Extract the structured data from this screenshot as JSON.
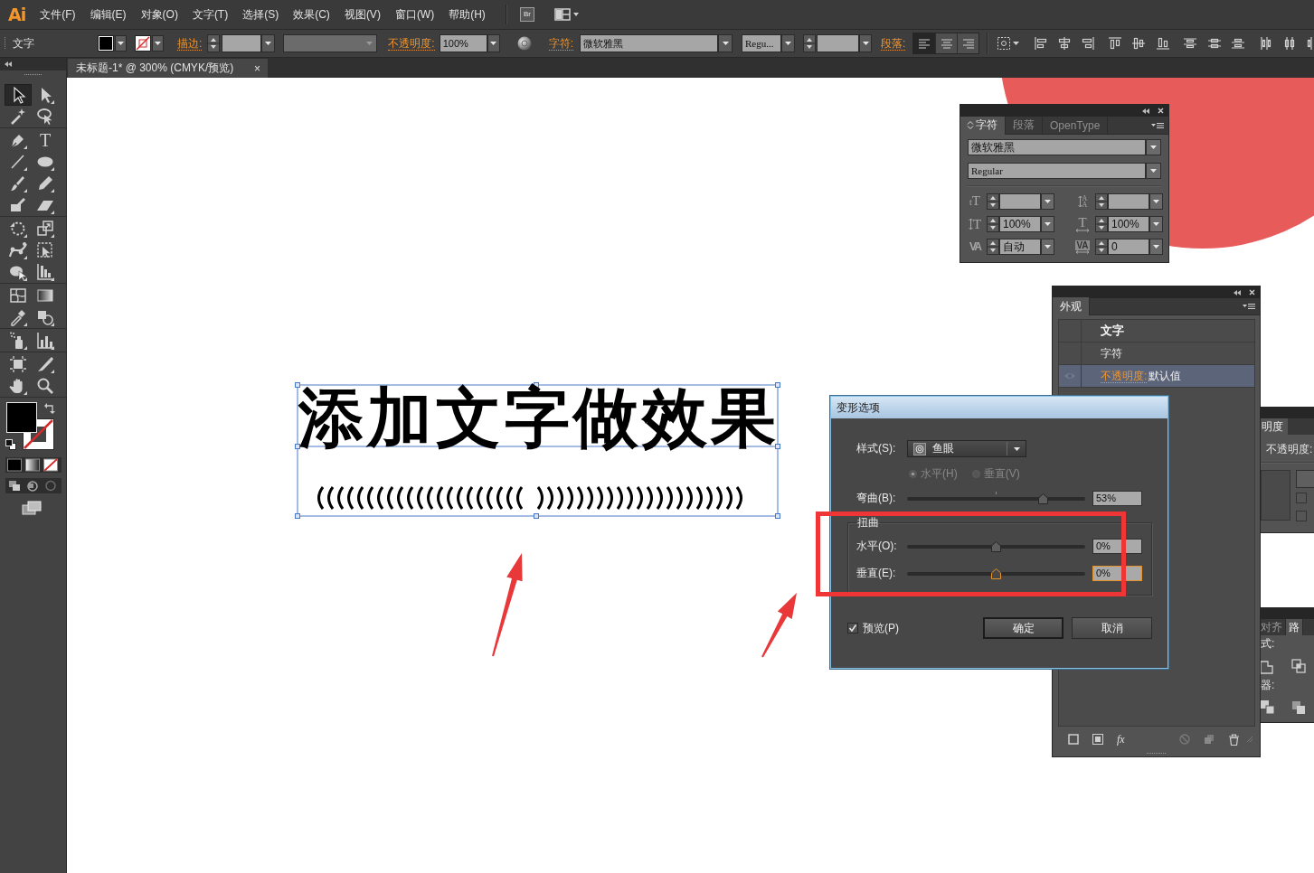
{
  "app": {
    "logo": "Ai",
    "bridge": "Br"
  },
  "menu": [
    "文件(F)",
    "编辑(E)",
    "对象(O)",
    "文字(T)",
    "选择(S)",
    "效果(C)",
    "视图(V)",
    "窗口(W)",
    "帮助(H)"
  ],
  "control_bar": {
    "selection": "文字",
    "stroke_label": "描边:",
    "opacity_label": "不透明度:",
    "opacity": "100%",
    "character_label": "字符:",
    "font": "微软雅黑",
    "font_style": "Regu...",
    "paragraph_label": "段落:",
    "alignment": [
      {
        "kind": "left",
        "selected": true
      },
      {
        "kind": "center",
        "selected": false
      },
      {
        "kind": "right",
        "selected": false
      }
    ]
  },
  "document_tab": {
    "title": "未标题-1* @ 300% (CMYK/预览)",
    "close": "×"
  },
  "tools": [
    {
      "kind": "selection",
      "selected": true
    },
    {
      "kind": "direct-selection",
      "selected": false
    },
    {
      "kind": "magic-wand",
      "selected": false
    },
    {
      "kind": "lasso",
      "selected": false
    },
    {
      "kind": "pen",
      "selected": false
    },
    {
      "kind": "type",
      "glyph": "T",
      "selected": false
    },
    {
      "kind": "line",
      "selected": false
    },
    {
      "kind": "ellipse",
      "selected": false
    },
    {
      "kind": "paintbrush",
      "selected": false
    },
    {
      "kind": "pencil",
      "selected": false
    },
    {
      "kind": "blob-brush",
      "selected": false
    },
    {
      "kind": "eraser",
      "selected": false
    },
    {
      "kind": "rotate",
      "selected": false
    },
    {
      "kind": "scale",
      "selected": false
    },
    {
      "kind": "width",
      "selected": false
    },
    {
      "kind": "free-transform",
      "selected": false
    },
    {
      "kind": "shape-builder",
      "selected": false
    },
    {
      "kind": "perspective-grid",
      "selected": false
    },
    {
      "kind": "mesh",
      "selected": false
    },
    {
      "kind": "gradient",
      "selected": false
    },
    {
      "kind": "eyedropper",
      "selected": false
    },
    {
      "kind": "blend",
      "selected": false
    },
    {
      "kind": "symbol-sprayer",
      "selected": false
    },
    {
      "kind": "column-graph",
      "selected": false
    },
    {
      "kind": "artboard",
      "selected": false
    },
    {
      "kind": "slice",
      "selected": false
    },
    {
      "kind": "hand",
      "selected": false
    },
    {
      "kind": "zoom",
      "selected": false
    }
  ],
  "artboard": {
    "text": "添加文字做效果"
  },
  "character_panel": {
    "tabs": [
      {
        "label": "字符",
        "selected": true
      },
      {
        "label": "段落",
        "selected": false
      },
      {
        "label": "OpenType",
        "selected": false
      }
    ],
    "font": "微软雅黑",
    "font_style": "Regular",
    "fields": [
      {
        "kind": "font-size",
        "glyph": "tT"
      },
      {
        "kind": "leading",
        "glyph": "AA"
      },
      {
        "kind": "vertical-scale",
        "glyph": "T",
        "value": "100%"
      },
      {
        "kind": "horizontal-scale",
        "glyph": "T",
        "value": "100%"
      },
      {
        "kind": "kerning",
        "glyph": "VA",
        "value": "自动"
      },
      {
        "kind": "tracking",
        "glyph": "VA",
        "value": "0"
      }
    ]
  },
  "appearance_panel": {
    "tab": "外观",
    "rows": [
      {
        "kind": "object",
        "label": "文字",
        "selected": false
      },
      {
        "kind": "group",
        "label": "字符",
        "selected": false
      },
      {
        "kind": "attribute",
        "label": "不透明度:",
        "value": "默认值",
        "selected": true
      }
    ],
    "fx": "fx"
  },
  "warp_dialog": {
    "title": "变形选项",
    "style_label": "样式(S):",
    "style": "鱼眼",
    "orientation": {
      "disabled": true,
      "options": [
        {
          "label": "水平(H)",
          "selected": true
        },
        {
          "label": "垂直(V)",
          "selected": false
        }
      ]
    },
    "bend": {
      "label": "弯曲(B):",
      "level": 0.765,
      "value": "53%"
    },
    "distortion": {
      "title": "扭曲",
      "sliders": [
        {
          "label": "水平(O):",
          "level": 0.5,
          "value": "0%",
          "focused": false
        },
        {
          "label": "垂直(E):",
          "level": 0.5,
          "value": "0%",
          "focused": true
        }
      ]
    },
    "preview": {
      "label": "预览(P)",
      "checked": true
    },
    "buttons": [
      {
        "label": "确定",
        "default": true
      },
      {
        "label": "取消",
        "default": false
      }
    ]
  },
  "transparency_panel": {
    "tab": "明度",
    "opacity_label": "不透明度:",
    "checkboxes": [
      {
        "checked": false
      },
      {
        "checked": false
      }
    ]
  },
  "pathfinder_panel": {
    "tabs": [
      {
        "label": "对齐",
        "selected": false
      },
      {
        "label": "路",
        "selected": true
      }
    ],
    "shape_modes_label": "式:",
    "pathfinders_label": "器:"
  }
}
